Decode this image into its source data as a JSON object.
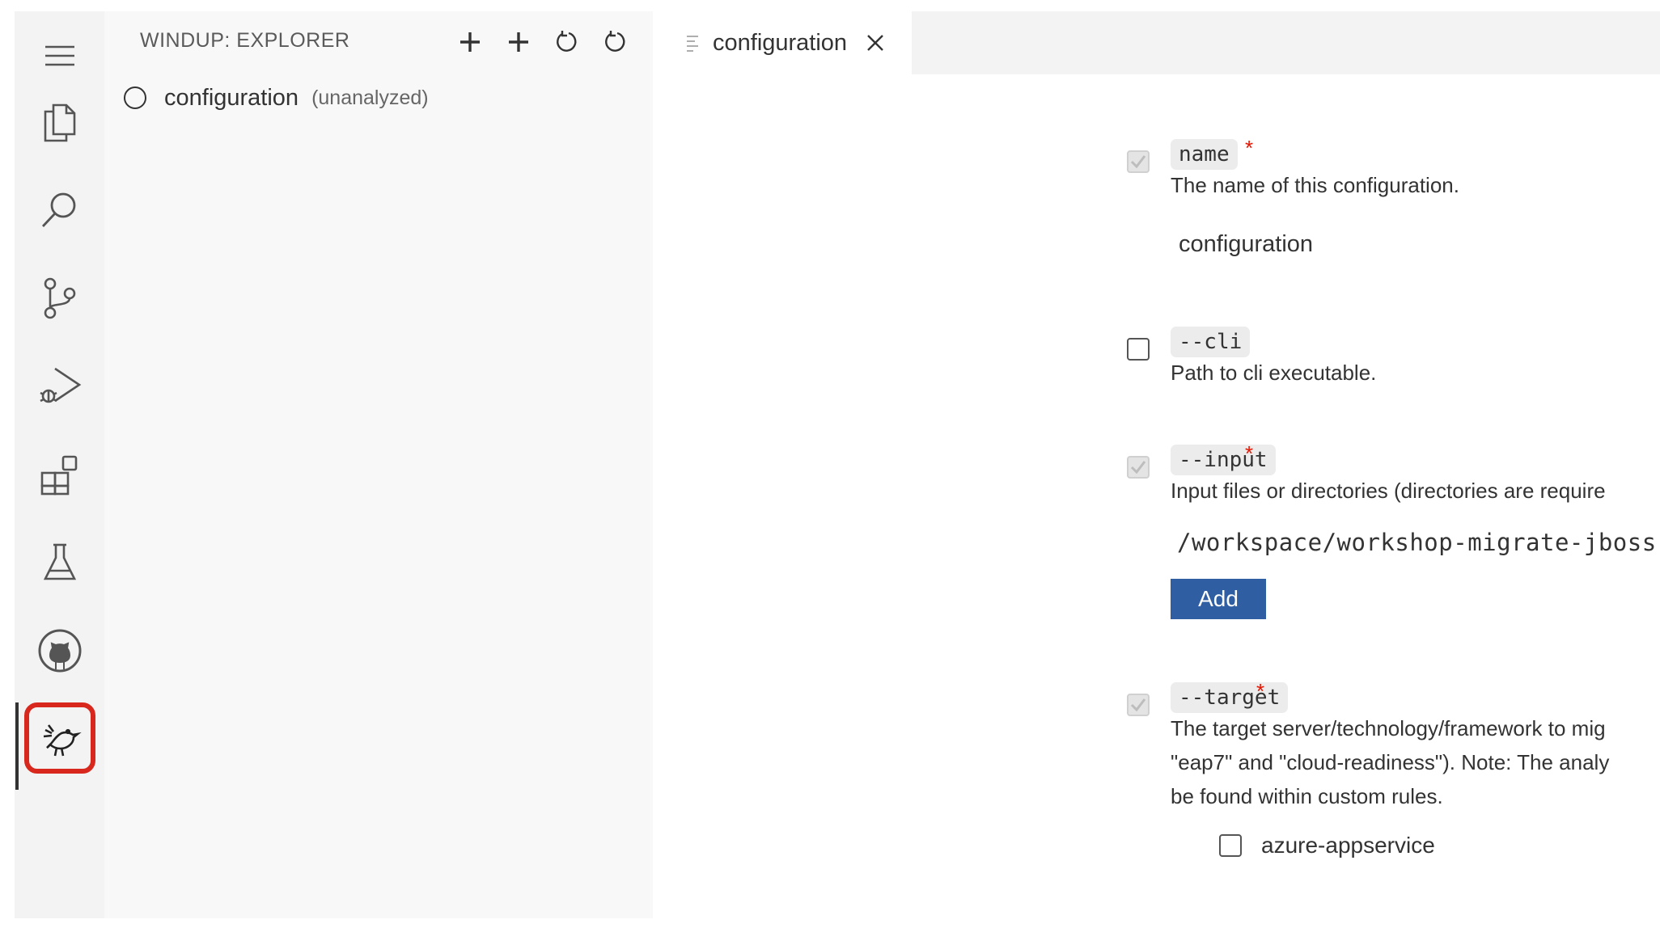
{
  "activity_bar": {
    "items": [
      {
        "icon": "menu-icon"
      },
      {
        "icon": "files-icon"
      },
      {
        "icon": "search-icon"
      },
      {
        "icon": "source-control-icon"
      },
      {
        "icon": "run-debug-icon"
      },
      {
        "icon": "extensions-icon"
      },
      {
        "icon": "testing-flask-icon"
      },
      {
        "icon": "github-icon"
      },
      {
        "icon": "windup-bird-icon",
        "active": true,
        "highlighted": true
      }
    ],
    "highlight_color": "#d8281e"
  },
  "sidebar": {
    "title": "WINDUP: EXPLORER",
    "actions": [
      {
        "icon": "plus-icon"
      },
      {
        "icon": "plus-icon"
      },
      {
        "icon": "refresh-icon"
      },
      {
        "icon": "refresh-icon"
      }
    ],
    "tree": [
      {
        "label": "configuration",
        "description": "(unanalyzed)",
        "icon": "circle-outline-icon"
      }
    ]
  },
  "editor": {
    "tab": {
      "label": "configuration",
      "icon": "file-lines-icon",
      "close_icon": "close-icon"
    },
    "options": [
      {
        "name": "name",
        "required": true,
        "required_mark": "*",
        "enabled": true,
        "disabled": true,
        "description": "The name of this configuration.",
        "value": "configuration"
      },
      {
        "name": "--cli",
        "required": false,
        "enabled": false,
        "description": "Path to cli executable."
      },
      {
        "name": "--input",
        "required": true,
        "required_mark": "*",
        "enabled": true,
        "disabled": true,
        "description": "Input files or directories (directories are require",
        "value": "/workspace/workshop-migrate-jboss-",
        "add_label": "Add"
      },
      {
        "name": "--target",
        "required": true,
        "required_mark": "*",
        "enabled": true,
        "disabled": true,
        "description_lines": [
          "The target server/technology/framework to mig",
          "\"eap7\" and \"cloud-readiness\"). Note: The analy",
          "be found within custom rules."
        ],
        "targets": [
          {
            "label": "azure-appservice",
            "checked": false
          }
        ]
      }
    ]
  },
  "colors": {
    "add_button": "#2f5ea2",
    "required_asterisk": "#e51400",
    "activity_bar_bg": "#f3f3f3",
    "sidebar_bg": "#f8f8f8"
  }
}
